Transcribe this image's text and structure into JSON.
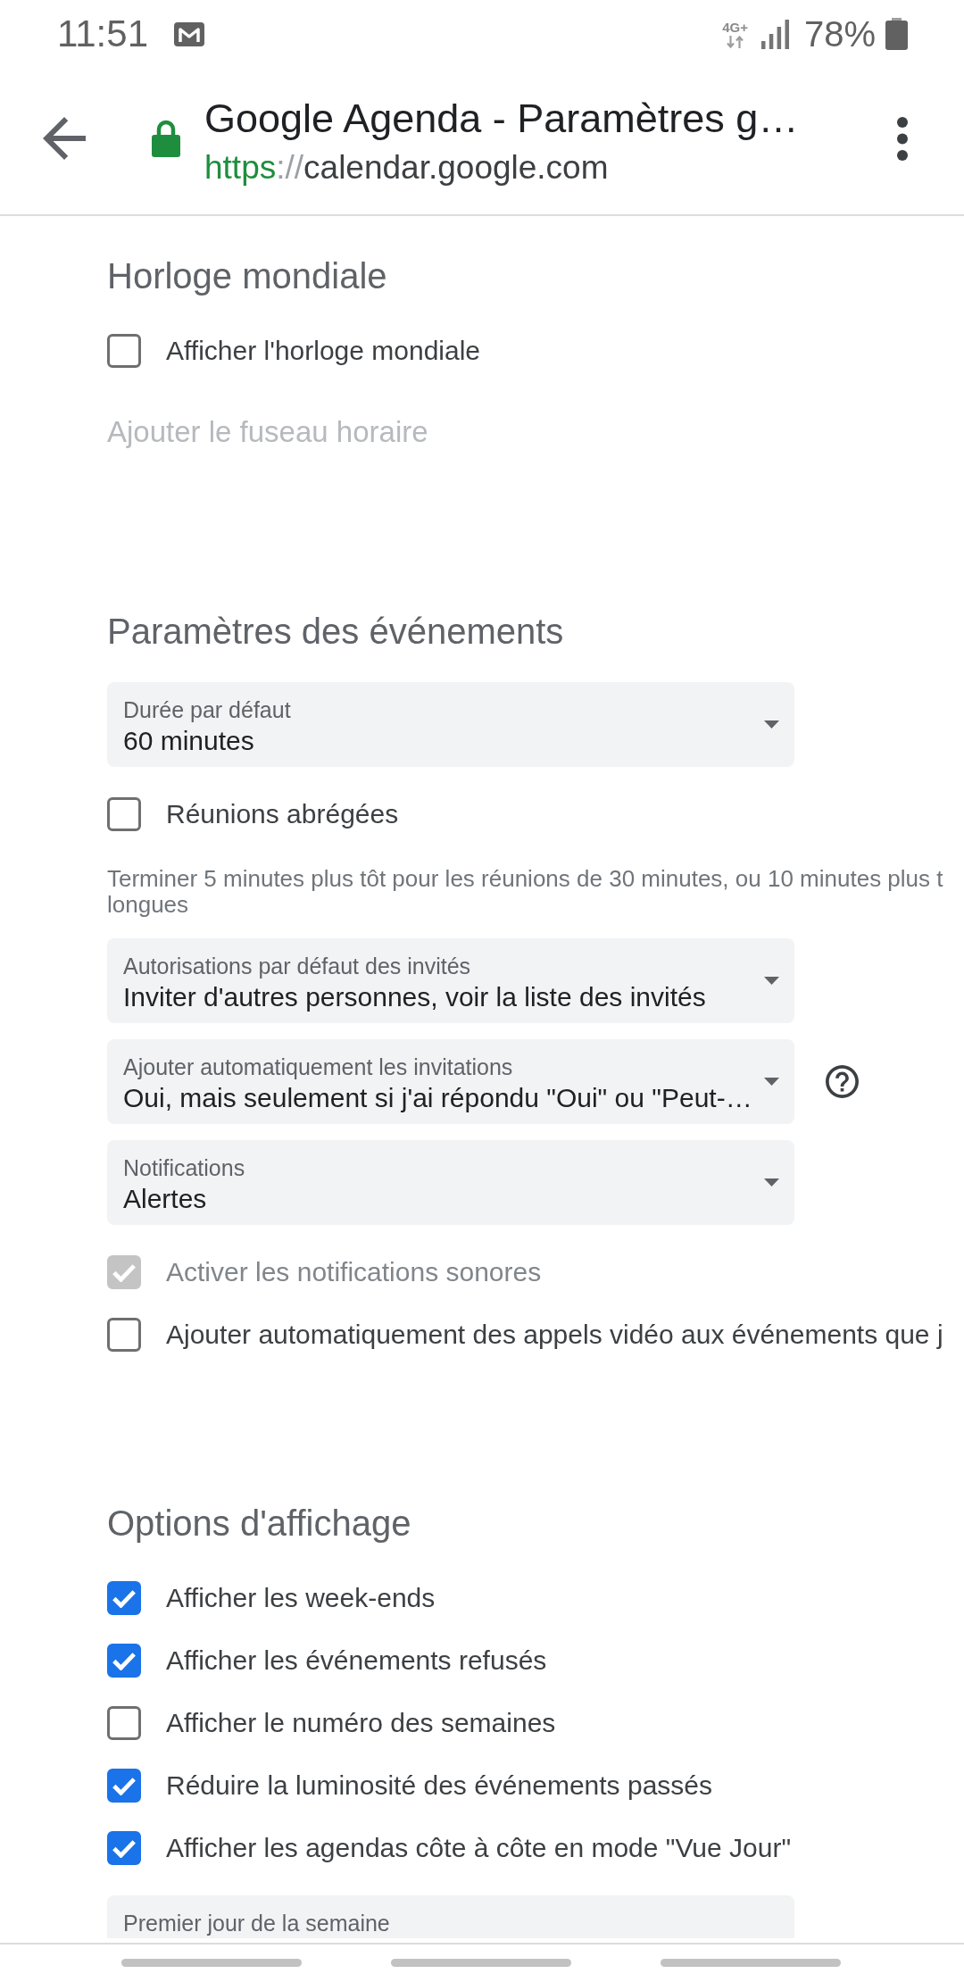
{
  "status_bar": {
    "time": "11:51",
    "network": "4G+",
    "battery": "78%"
  },
  "toolbar": {
    "title": "Google Agenda - Paramètres g…",
    "secure": true,
    "url": {
      "scheme": "https",
      "separator": "://",
      "host": "calendar.google.com"
    }
  },
  "sections": [
    {
      "title": "Horloge mondiale",
      "items": [
        {
          "kind": "checkbox",
          "label": "Afficher l'horloge mondiale",
          "checked": false,
          "disabled": false
        },
        {
          "kind": "action",
          "label": "Ajouter le fuseau horaire",
          "disabled": true
        }
      ]
    },
    {
      "title": "Paramètres des événements",
      "items": [
        {
          "kind": "dropdown",
          "label": "Durée par défaut",
          "value": "60 minutes",
          "help": false
        },
        {
          "kind": "checkbox",
          "label": "Réunions abrégées",
          "checked": false,
          "disabled": false
        },
        {
          "kind": "note",
          "lines": [
            "Terminer 5 minutes plus tôt pour les réunions de 30 minutes, ou 10 minutes plus t",
            "longues"
          ]
        },
        {
          "kind": "dropdown",
          "label": "Autorisations par défaut des invités",
          "value": "Inviter d'autres personnes, voir la liste des invités",
          "help": false
        },
        {
          "kind": "dropdown",
          "label": "Ajouter automatiquement les invitations",
          "value": "Oui, mais seulement si j'ai répondu \"Oui\" ou \"Peut-…",
          "help": true
        },
        {
          "kind": "dropdown",
          "label": "Notifications",
          "value": "Alertes",
          "help": false
        },
        {
          "kind": "checkbox",
          "label": "Activer les notifications sonores",
          "checked": true,
          "disabled": true
        },
        {
          "kind": "checkbox",
          "label": "Ajouter automatiquement des appels vidéo aux événements que j",
          "checked": false,
          "disabled": false
        }
      ]
    },
    {
      "title": "Options d'affichage",
      "items": [
        {
          "kind": "checkbox",
          "label": "Afficher les week-ends",
          "checked": true,
          "disabled": false
        },
        {
          "kind": "checkbox",
          "label": "Afficher les événements refusés",
          "checked": true,
          "disabled": false
        },
        {
          "kind": "checkbox",
          "label": "Afficher le numéro des semaines",
          "checked": false,
          "disabled": false
        },
        {
          "kind": "checkbox",
          "label": "Réduire la luminosité des événements passés",
          "checked": true,
          "disabled": false
        },
        {
          "kind": "checkbox",
          "label": "Afficher les agendas côte à côte en mode \"Vue Jour\"",
          "checked": true,
          "disabled": false
        },
        {
          "kind": "dropdown",
          "label": "Premier jour de la semaine",
          "help": false
        }
      ]
    }
  ]
}
